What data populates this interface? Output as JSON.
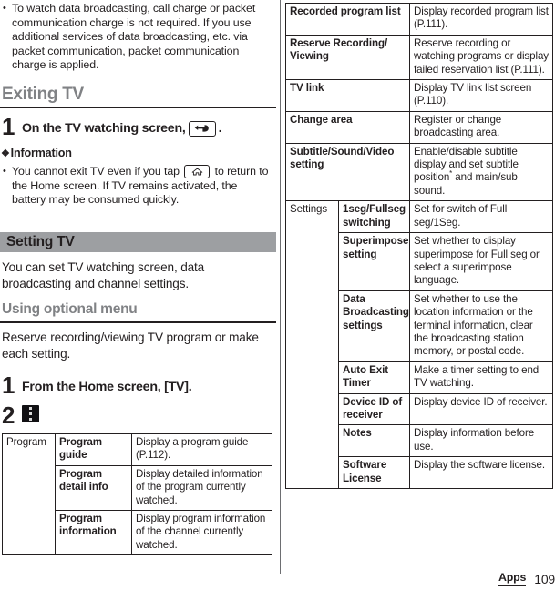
{
  "left": {
    "intro_bullets": [
      "To watch data broadcasting, call charge or packet communication charge is not required. If you use additional services of data broadcasting, etc. via packet communication, packet communication charge is applied."
    ],
    "exiting_tv": {
      "heading": "Exiting TV",
      "step_number": "1",
      "step_text_before": "On the TV watching screen,",
      "step_icon": "back-arrow-icon",
      "step_text_after": ".",
      "information_label": "Information",
      "information_symbol": "❖",
      "information_bullet_before": "You cannot exit TV even if you tap",
      "information_bullet_icon": "home-icon",
      "information_bullet_after": "to return to the Home screen. If TV remains activated, the battery may be consumed quickly."
    },
    "setting_tv": {
      "banner_title": "Setting TV",
      "paragraph": "You can set TV watching screen, data broadcasting and channel settings.",
      "subheading": "Using optional menu",
      "subparagraph": "Reserve recording/viewing TV program or make each setting.",
      "step1_number": "1",
      "step1_text": "From the Home screen, [TV].",
      "step2_number": "2",
      "step2_icon": "overflow-menu-icon"
    },
    "table_rows": [
      {
        "col1": "Program",
        "col1_rowspan": 3,
        "col2": "Program guide",
        "col3": "Display a program guide (P.112)."
      },
      {
        "col1": null,
        "col2": "Program detail info",
        "col3": "Display detailed information of the program currently watched."
      },
      {
        "col1": null,
        "col2": "Program information",
        "col3": "Display program information of the channel currently watched."
      }
    ]
  },
  "right": {
    "table_rows": [
      {
        "col1": "Recorded program list",
        "col1_span": 2,
        "col3": "Display recorded program list (P.111)."
      },
      {
        "col1": "Reserve Recording/ Viewing",
        "col1_span": 2,
        "col3": "Reserve recording or watching programs or display failed reservation list (P.111)."
      },
      {
        "col1": "TV link",
        "col1_span": 2,
        "col3": "Display TV link list screen (P.110)."
      },
      {
        "col1": "Change area",
        "col1_span": 2,
        "col3": "Register or change broadcasting area."
      },
      {
        "col1": "Subtitle/Sound/Video setting",
        "col1_span": 2,
        "col3": "Enable/disable subtitle display and set subtitle position* and main/sub sound.",
        "col3_has_superscript": true,
        "col3_part_a": "Enable/disable subtitle display and set subtitle position",
        "col3_sup": "*",
        "col3_part_b": " and main/sub sound."
      },
      {
        "col1": "Settings",
        "col1_rowspan": 7,
        "col2": "1seg/Fullseg switching",
        "col3": "Set for switch of Full seg/1Seg."
      },
      {
        "col1": null,
        "col2": "Superimpose setting",
        "col3": "Set whether to display superimpose for Full seg or select a superimpose language."
      },
      {
        "col1": null,
        "col2": "Data Broadcasting settings",
        "col3": "Set whether to use the location information or the terminal information, clear the broadcasting station memory, or postal code."
      },
      {
        "col1": null,
        "col2": "Auto Exit Timer",
        "col3": "Make a timer setting to end TV watching."
      },
      {
        "col1": null,
        "col2": "Device ID of receiver",
        "col3": "Display device ID of receiver."
      },
      {
        "col1": null,
        "col2": "Notes",
        "col3": "Display information before use."
      },
      {
        "col1": null,
        "col2": "Software License",
        "col3": "Display the software license."
      }
    ]
  },
  "footer": {
    "chapter": "Apps",
    "page_number": "109"
  },
  "colors": {
    "heading_gray": "#808285",
    "banner_gray": "#9d9fa2",
    "text_black": "#231f20",
    "menu_chip": "#111013"
  }
}
